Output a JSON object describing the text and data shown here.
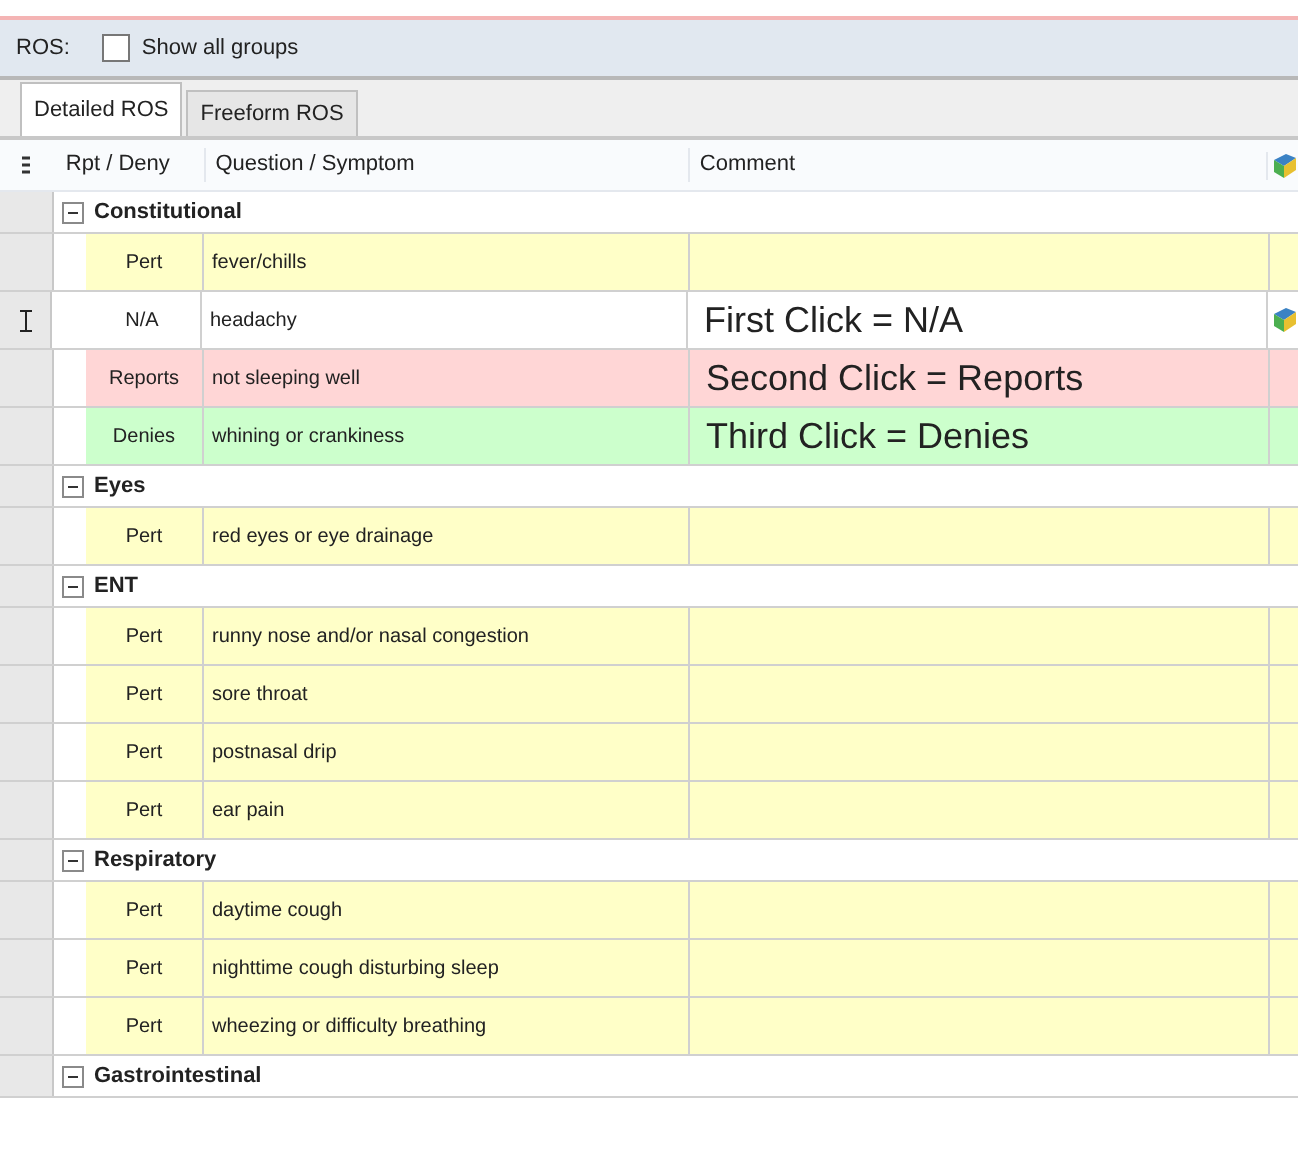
{
  "header": {
    "label": "ROS:",
    "show_all_groups": {
      "label": "Show all groups",
      "checked": false
    }
  },
  "tabs": [
    {
      "label": "Detailed ROS",
      "selected": true
    },
    {
      "label": "Freeform ROS",
      "selected": false
    }
  ],
  "table": {
    "columns": [
      "Rpt / Deny",
      "Question / Symptom",
      "Comment"
    ],
    "groups": [
      {
        "name": "Constitutional",
        "expanded": true,
        "rows": [
          {
            "kind": "pert",
            "value": "Pert",
            "symptom": "fever/chills",
            "comment": "",
            "comment_icon": false,
            "cursor": false
          },
          {
            "kind": "na",
            "value": "N/A",
            "symptom": "headachy",
            "comment": "First Click = N/A",
            "comment_icon": true,
            "cursor": true
          },
          {
            "kind": "reports",
            "value": "Reports",
            "symptom": "not sleeping well",
            "comment": "Second Click = Reports",
            "comment_icon": false,
            "cursor": false
          },
          {
            "kind": "denies",
            "value": "Denies",
            "symptom": "whining or crankiness",
            "comment": "Third Click = Denies",
            "comment_icon": false,
            "cursor": false
          }
        ]
      },
      {
        "name": "Eyes",
        "expanded": true,
        "rows": [
          {
            "kind": "pert",
            "value": "Pert",
            "symptom": "red eyes or eye drainage",
            "comment": "",
            "comment_icon": false,
            "cursor": false
          }
        ]
      },
      {
        "name": "ENT",
        "expanded": true,
        "rows": [
          {
            "kind": "pert",
            "value": "Pert",
            "symptom": "runny nose and/or nasal congestion",
            "comment": "",
            "comment_icon": false,
            "cursor": false
          },
          {
            "kind": "pert",
            "value": "Pert",
            "symptom": "sore throat",
            "comment": "",
            "comment_icon": false,
            "cursor": false
          },
          {
            "kind": "pert",
            "value": "Pert",
            "symptom": "postnasal drip",
            "comment": "",
            "comment_icon": false,
            "cursor": false
          },
          {
            "kind": "pert",
            "value": "Pert",
            "symptom": "ear pain",
            "comment": "",
            "comment_icon": false,
            "cursor": false
          }
        ]
      },
      {
        "name": "Respiratory",
        "expanded": true,
        "rows": [
          {
            "kind": "pert",
            "value": "Pert",
            "symptom": "daytime cough",
            "comment": "",
            "comment_icon": false,
            "cursor": false
          },
          {
            "kind": "pert",
            "value": "Pert",
            "symptom": "nighttime cough disturbing sleep",
            "comment": "",
            "comment_icon": false,
            "cursor": false
          },
          {
            "kind": "pert",
            "value": "Pert",
            "symptom": "wheezing or difficulty breathing",
            "comment": "",
            "comment_icon": false,
            "cursor": false
          }
        ]
      },
      {
        "name": "Gastrointestinal",
        "expanded": true
      }
    ]
  }
}
